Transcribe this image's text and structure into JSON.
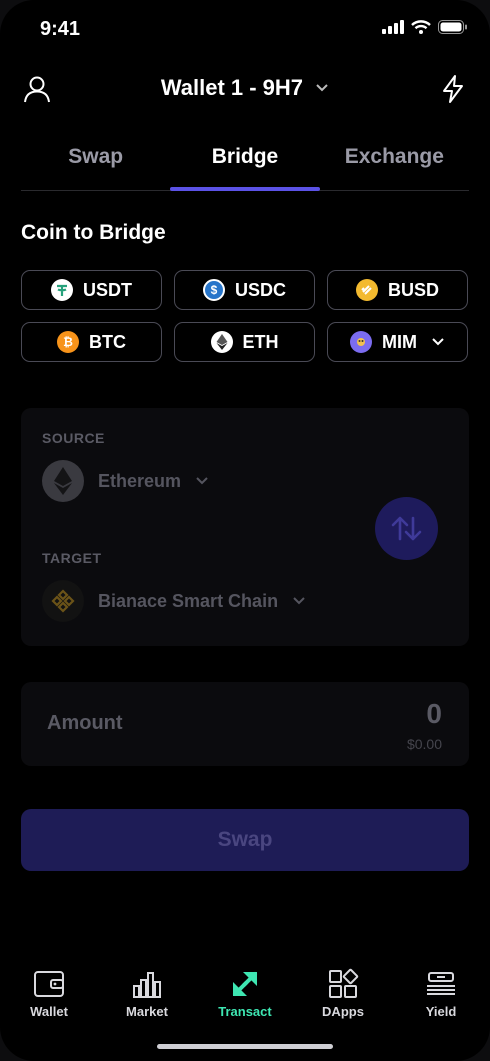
{
  "status_bar": {
    "time": "9:41"
  },
  "header": {
    "wallet_title": "Wallet 1 - 9H7"
  },
  "tabs": [
    {
      "label": "Swap"
    },
    {
      "label": "Bridge"
    },
    {
      "label": "Exchange"
    }
  ],
  "active_tab": "Bridge",
  "coin_section": {
    "title": "Coin to Bridge",
    "coins": [
      {
        "label": "USDT",
        "icon": "usdt-icon",
        "color": "#26a17b"
      },
      {
        "label": "USDC",
        "icon": "usdc-icon",
        "color": "#2775ca"
      },
      {
        "label": "BUSD",
        "icon": "busd-icon",
        "color": "#f3ba2f"
      },
      {
        "label": "BTC",
        "icon": "btc-icon",
        "color": "#f7931a"
      },
      {
        "label": "ETH",
        "icon": "eth-icon",
        "color": "#ffffff"
      },
      {
        "label": "MIM",
        "icon": "mim-icon",
        "color": "#7b6cf0"
      }
    ]
  },
  "bridge": {
    "source_label": "SOURCE",
    "source_chain": "Ethereum",
    "target_label": "TARGET",
    "target_chain": "Bianace Smart Chain"
  },
  "amount": {
    "label": "Amount",
    "value": "0",
    "fiat": "$0.00"
  },
  "swap_button": {
    "label": "Swap"
  },
  "bottom_nav": [
    {
      "label": "Wallet",
      "icon": "wallet-icon"
    },
    {
      "label": "Market",
      "icon": "market-icon"
    },
    {
      "label": "Transact",
      "icon": "transact-icon"
    },
    {
      "label": "DApps",
      "icon": "dapps-icon"
    },
    {
      "label": "Yield",
      "icon": "yield-icon"
    }
  ],
  "colors": {
    "accent": "#5b52e6",
    "active_nav": "#3ee6b2",
    "swap_button_bg": "#1e1c56"
  }
}
